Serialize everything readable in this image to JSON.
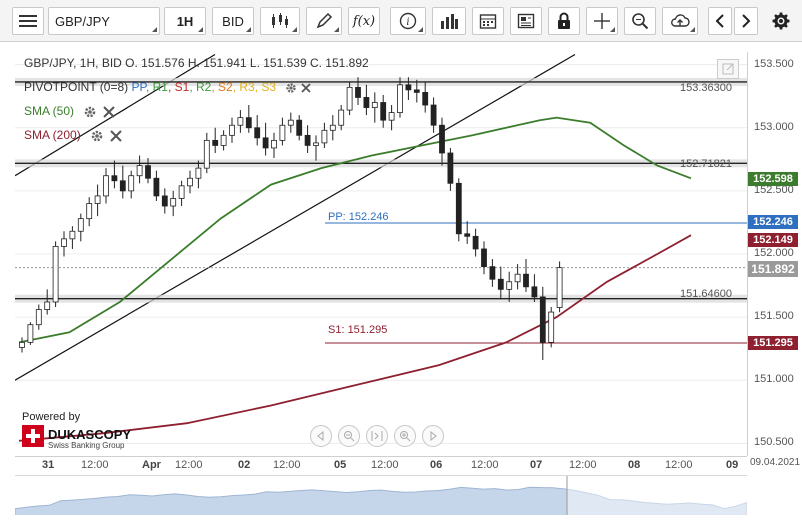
{
  "toolbar": {
    "menu_icon": "hamburger-icon",
    "instrument": "GBP/JPY",
    "timeframe": "1H",
    "price_side": "BID",
    "fx_label": "f(x)"
  },
  "legend": {
    "ohlc": "GBP/JPY, 1H, BID   O. 151.576 H. 151.941 L. 151.539 C. 151.892",
    "pivot_name": "PIVOTPOINT (0=8)",
    "pivot_items": [
      {
        "label": "PP",
        "color": "#2f6fbf"
      },
      {
        "label": "R1",
        "color": "#3a9a3a"
      },
      {
        "label": "S1",
        "color": "#c02a2a"
      },
      {
        "label": "R2",
        "color": "#3a9a3a"
      },
      {
        "label": "S2",
        "color": "#e07a1a"
      },
      {
        "label": "R3",
        "color": "#e0b020"
      },
      {
        "label": "S3",
        "color": "#e0b020"
      }
    ],
    "sma50": "SMA (50)",
    "sma200": "SMA (200)"
  },
  "levels": {
    "top_line": "153.36300",
    "mid_line": "152.71821",
    "pp": "PP: 152.246",
    "low_line": "151.64600",
    "s1": "S1: 151.295"
  },
  "y_axis": {
    "ticks": [
      "153.500",
      "153.000",
      "152.500",
      "152.000",
      "151.500",
      "151.000",
      "150.500"
    ],
    "tags": [
      {
        "label": "152.598",
        "color": "#3b7d2c"
      },
      {
        "label": "152.246",
        "color": "#2f6fbf"
      },
      {
        "label": "152.149",
        "color": "#8e2030"
      },
      {
        "label": "151.892",
        "color": "#9a9a9a"
      },
      {
        "label": "151.295",
        "color": "#8e2030"
      }
    ]
  },
  "x_axis": {
    "labels": [
      {
        "text": "31",
        "major": true
      },
      {
        "text": "12:00",
        "major": false
      },
      {
        "text": "Apr",
        "major": true
      },
      {
        "text": "12:00",
        "major": false
      },
      {
        "text": "02",
        "major": true
      },
      {
        "text": "12:00",
        "major": false
      },
      {
        "text": "05",
        "major": true
      },
      {
        "text": "12:00",
        "major": false
      },
      {
        "text": "06",
        "major": true
      },
      {
        "text": "12:00",
        "major": false
      },
      {
        "text": "07",
        "major": true
      },
      {
        "text": "12:00",
        "major": false
      },
      {
        "text": "08",
        "major": true
      },
      {
        "text": "12:00",
        "major": false
      },
      {
        "text": "09",
        "major": true
      }
    ],
    "current_date": "09.04.2021"
  },
  "branding": {
    "powered_by": "Powered by",
    "name": "DUKASCOPY",
    "tagline": "Swiss Banking Group"
  },
  "chart_data": {
    "type": "candlestick",
    "y_range": [
      150.4,
      153.6
    ],
    "ohlc": [
      [
        151.26,
        151.34,
        151.22,
        151.3
      ],
      [
        151.3,
        151.46,
        151.28,
        151.44
      ],
      [
        151.44,
        151.6,
        151.4,
        151.56
      ],
      [
        151.56,
        151.72,
        151.52,
        151.62
      ],
      [
        151.62,
        152.1,
        151.58,
        152.06
      ],
      [
        152.06,
        152.18,
        151.98,
        152.12
      ],
      [
        152.12,
        152.22,
        152.04,
        152.18
      ],
      [
        152.18,
        152.32,
        152.1,
        152.28
      ],
      [
        152.28,
        152.45,
        152.22,
        152.4
      ],
      [
        152.4,
        152.55,
        152.3,
        152.46
      ],
      [
        152.46,
        152.68,
        152.4,
        152.62
      ],
      [
        152.62,
        152.74,
        152.52,
        152.58
      ],
      [
        152.58,
        152.7,
        152.44,
        152.5
      ],
      [
        152.5,
        152.66,
        152.44,
        152.62
      ],
      [
        152.62,
        152.78,
        152.56,
        152.7
      ],
      [
        152.7,
        152.76,
        152.56,
        152.6
      ],
      [
        152.6,
        152.66,
        152.42,
        152.46
      ],
      [
        152.46,
        152.52,
        152.32,
        152.38
      ],
      [
        152.38,
        152.5,
        152.3,
        152.44
      ],
      [
        152.44,
        152.58,
        152.38,
        152.54
      ],
      [
        152.54,
        152.66,
        152.48,
        152.6
      ],
      [
        152.6,
        152.74,
        152.52,
        152.68
      ],
      [
        152.68,
        152.96,
        152.64,
        152.9
      ],
      [
        152.9,
        153.0,
        152.8,
        152.86
      ],
      [
        152.86,
        152.98,
        152.82,
        152.94
      ],
      [
        152.94,
        153.08,
        152.88,
        153.02
      ],
      [
        153.02,
        153.14,
        152.96,
        153.08
      ],
      [
        153.08,
        153.18,
        152.96,
        153.0
      ],
      [
        153.0,
        153.1,
        152.86,
        152.92
      ],
      [
        152.92,
        153.04,
        152.78,
        152.84
      ],
      [
        152.84,
        152.96,
        152.76,
        152.9
      ],
      [
        152.9,
        153.08,
        152.86,
        153.02
      ],
      [
        153.02,
        153.12,
        152.96,
        153.06
      ],
      [
        153.06,
        153.1,
        152.9,
        152.94
      ],
      [
        152.94,
        153.02,
        152.8,
        152.86
      ],
      [
        152.86,
        152.94,
        152.74,
        152.88
      ],
      [
        152.88,
        153.04,
        152.84,
        152.98
      ],
      [
        152.98,
        153.1,
        152.9,
        153.02
      ],
      [
        153.02,
        153.18,
        152.98,
        153.14
      ],
      [
        153.14,
        153.36,
        153.1,
        153.32
      ],
      [
        153.32,
        153.4,
        153.18,
        153.24
      ],
      [
        153.24,
        153.34,
        153.1,
        153.16
      ],
      [
        153.16,
        153.28,
        153.04,
        153.2
      ],
      [
        153.2,
        153.26,
        153.0,
        153.06
      ],
      [
        153.06,
        153.18,
        152.98,
        153.12
      ],
      [
        153.12,
        153.4,
        153.08,
        153.34
      ],
      [
        153.34,
        153.4,
        153.22,
        153.3
      ],
      [
        153.3,
        153.38,
        153.2,
        153.28
      ],
      [
        153.28,
        153.36,
        153.12,
        153.18
      ],
      [
        153.18,
        153.24,
        152.96,
        153.02
      ],
      [
        153.02,
        153.08,
        152.7,
        152.8
      ],
      [
        152.8,
        152.84,
        152.5,
        152.56
      ],
      [
        152.56,
        152.6,
        152.1,
        152.16
      ],
      [
        152.16,
        152.26,
        152.08,
        152.14
      ],
      [
        152.14,
        152.2,
        151.98,
        152.04
      ],
      [
        152.04,
        152.1,
        151.84,
        151.9
      ],
      [
        151.9,
        151.96,
        151.74,
        151.8
      ],
      [
        151.8,
        151.9,
        151.64,
        151.72
      ],
      [
        151.72,
        151.86,
        151.62,
        151.78
      ],
      [
        151.78,
        151.92,
        151.72,
        151.84
      ],
      [
        151.84,
        151.96,
        151.7,
        151.74
      ],
      [
        151.74,
        151.84,
        151.62,
        151.66
      ],
      [
        151.66,
        151.74,
        151.16,
        151.3
      ],
      [
        151.3,
        151.58,
        151.26,
        151.54
      ],
      [
        151.576,
        151.941,
        151.539,
        151.892
      ]
    ],
    "sma50": [
      [
        0,
        151.3
      ],
      [
        6,
        151.38
      ],
      [
        12,
        151.62
      ],
      [
        18,
        151.95
      ],
      [
        24,
        152.28
      ],
      [
        30,
        152.55
      ],
      [
        36,
        152.68
      ],
      [
        42,
        152.78
      ],
      [
        48,
        152.86
      ],
      [
        54,
        152.94
      ],
      [
        58,
        153.0
      ],
      [
        62,
        153.06
      ],
      [
        64,
        153.08
      ],
      [
        68,
        153.04
      ],
      [
        72,
        152.86
      ],
      [
        76,
        152.7
      ],
      [
        80,
        152.6
      ]
    ],
    "sma200": [
      [
        0,
        150.52
      ],
      [
        10,
        150.58
      ],
      [
        20,
        150.66
      ],
      [
        30,
        150.8
      ],
      [
        40,
        150.96
      ],
      [
        50,
        151.12
      ],
      [
        58,
        151.3
      ],
      [
        64,
        151.5
      ],
      [
        70,
        151.78
      ],
      [
        76,
        152.0
      ],
      [
        80,
        152.149
      ]
    ],
    "levels": [
      153.363,
      152.71821,
      152.246,
      151.646,
      151.295
    ],
    "last_price": 151.892
  }
}
